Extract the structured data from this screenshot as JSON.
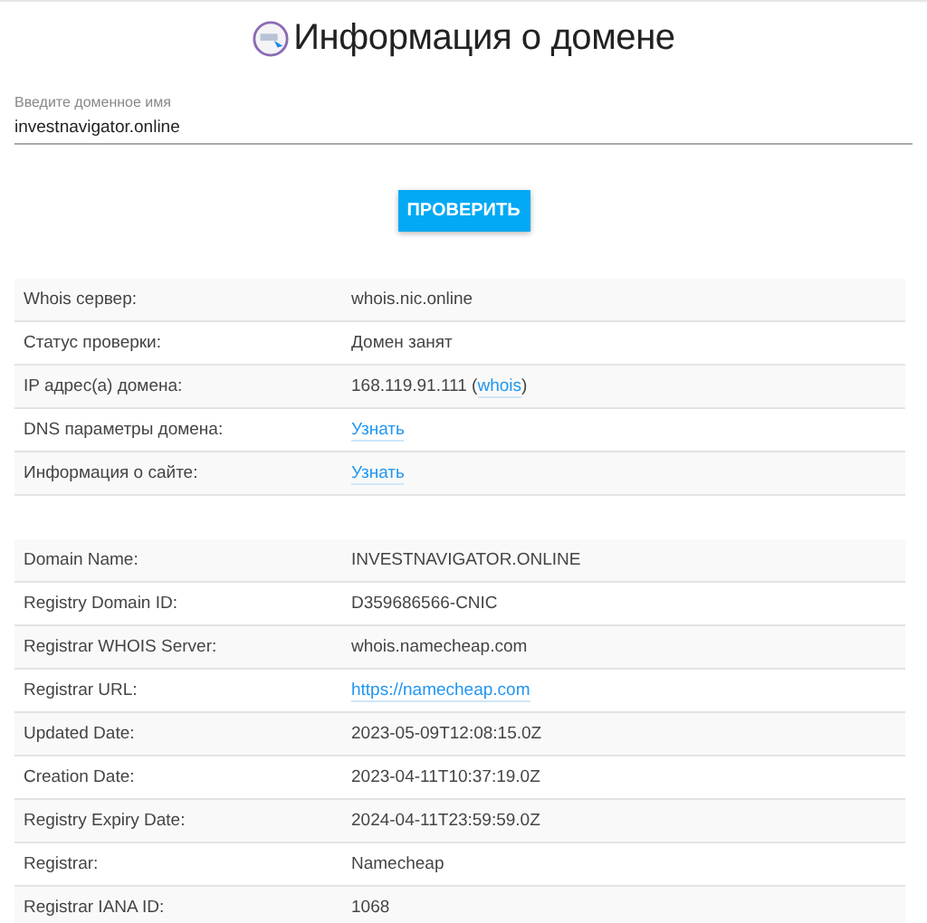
{
  "title": "Информация о домене",
  "domain_field": {
    "label": "Введите доменное имя",
    "value": "investnavigator.online"
  },
  "check_button": "ПРОВЕРИТЬ",
  "summary_table": [
    {
      "label": "Whois сервер:",
      "value": [
        {
          "text": "whois.nic.online",
          "link": false
        }
      ]
    },
    {
      "label": "Статус проверки:",
      "value": [
        {
          "text": "Домен занят",
          "link": false
        }
      ]
    },
    {
      "label": "IP адрес(а) домена:",
      "value": [
        {
          "text": "168.119.91.111 (",
          "link": false
        },
        {
          "text": "whois",
          "link": true
        },
        {
          "text": ")",
          "link": false
        }
      ]
    },
    {
      "label": "DNS параметры домена:",
      "value": [
        {
          "text": "Узнать",
          "link": true
        }
      ]
    },
    {
      "label": "Информация о сайте:",
      "value": [
        {
          "text": "Узнать",
          "link": true
        }
      ]
    }
  ],
  "whois_table": [
    {
      "label": "Domain Name:",
      "value": [
        {
          "text": "INVESTNAVIGATOR.ONLINE",
          "link": false
        }
      ]
    },
    {
      "label": "Registry Domain ID:",
      "value": [
        {
          "text": "D359686566-CNIC",
          "link": false
        }
      ]
    },
    {
      "label": "Registrar WHOIS Server:",
      "value": [
        {
          "text": "whois.namecheap.com",
          "link": false
        }
      ]
    },
    {
      "label": "Registrar URL:",
      "value": [
        {
          "text": "https://namecheap.com",
          "link": true
        }
      ]
    },
    {
      "label": "Updated Date:",
      "value": [
        {
          "text": "2023-05-09T12:08:15.0Z",
          "link": false
        }
      ]
    },
    {
      "label": "Creation Date:",
      "value": [
        {
          "text": "2023-04-11T10:37:19.0Z",
          "link": false
        }
      ]
    },
    {
      "label": "Registry Expiry Date:",
      "value": [
        {
          "text": "2024-04-11T23:59:59.0Z",
          "link": false
        }
      ]
    },
    {
      "label": "Registrar:",
      "value": [
        {
          "text": "Namecheap",
          "link": false
        }
      ]
    },
    {
      "label": "Registrar IANA ID:",
      "value": [
        {
          "text": "1068",
          "link": false
        }
      ]
    }
  ]
}
